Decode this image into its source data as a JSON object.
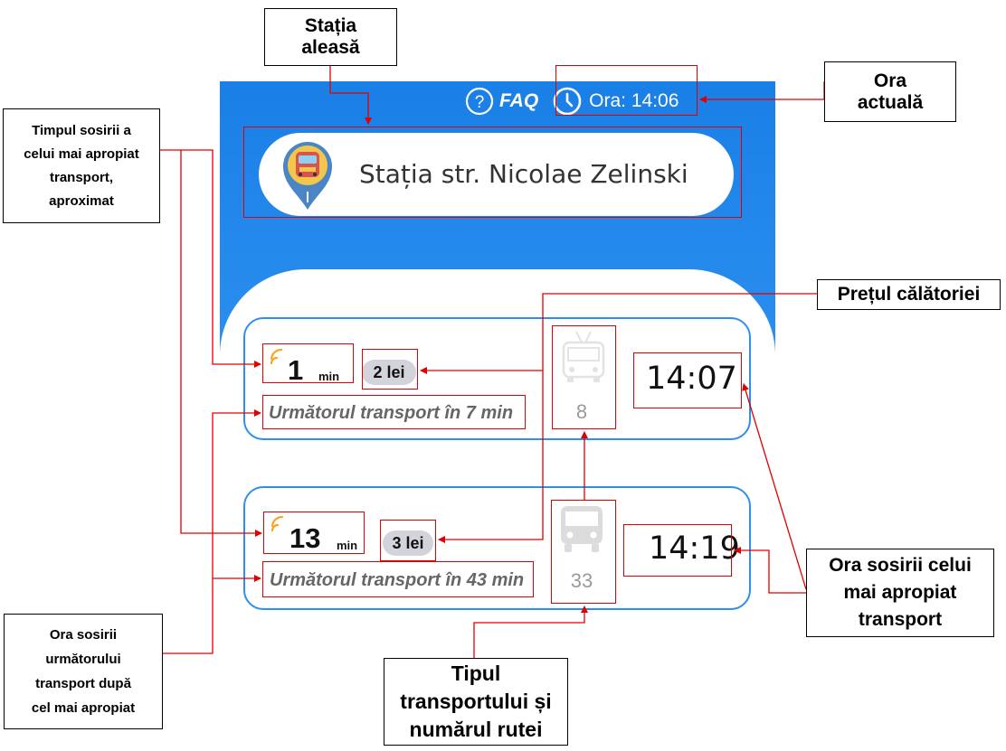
{
  "header": {
    "faq_label": "FAQ",
    "time_label": "Ora: 14:06",
    "help_icon": "question-circle-icon",
    "clock_icon": "clock-icon"
  },
  "station": {
    "name": "Stația str. Nicolae Zelinski",
    "icon": "bus-stop-pin-icon"
  },
  "arrivals": [
    {
      "minutes": "1",
      "minutes_unit": "min",
      "price": "2 lei",
      "next_text": "Următorul transport în 7 min",
      "vehicle_icon": "trolleybus-icon",
      "route": "8",
      "arrival_time": "14:07"
    },
    {
      "minutes": "13",
      "minutes_unit": "min",
      "price": "3 lei",
      "next_text": "Următorul transport în 43 min",
      "vehicle_icon": "bus-icon",
      "route": "33",
      "arrival_time": "14:19"
    }
  ],
  "annotations": {
    "selected_station": [
      "Stația",
      "aleasă"
    ],
    "current_time": [
      "Ora",
      "actuală"
    ],
    "nearest_arrival_approx": [
      "Timpul sosirii a",
      "celui mai apropiat",
      "transport,",
      "aproximat"
    ],
    "trip_price": [
      "Prețul călătoriei"
    ],
    "next_after_nearest": [
      "Ora sosirii",
      "următorului",
      "transport după",
      "cel mai apropiat"
    ],
    "vehicle_type_route": [
      "Tipul",
      "transportului și",
      "numărul rutei"
    ],
    "nearest_arrival_time": [
      "Ora sosirii celui",
      "mai apropiat",
      "transport"
    ]
  },
  "colors": {
    "primary_blue": "#1a7fe6",
    "card_border": "#2e8ff0",
    "annotation_red": "#e00000",
    "signal_orange": "#f5a623"
  }
}
